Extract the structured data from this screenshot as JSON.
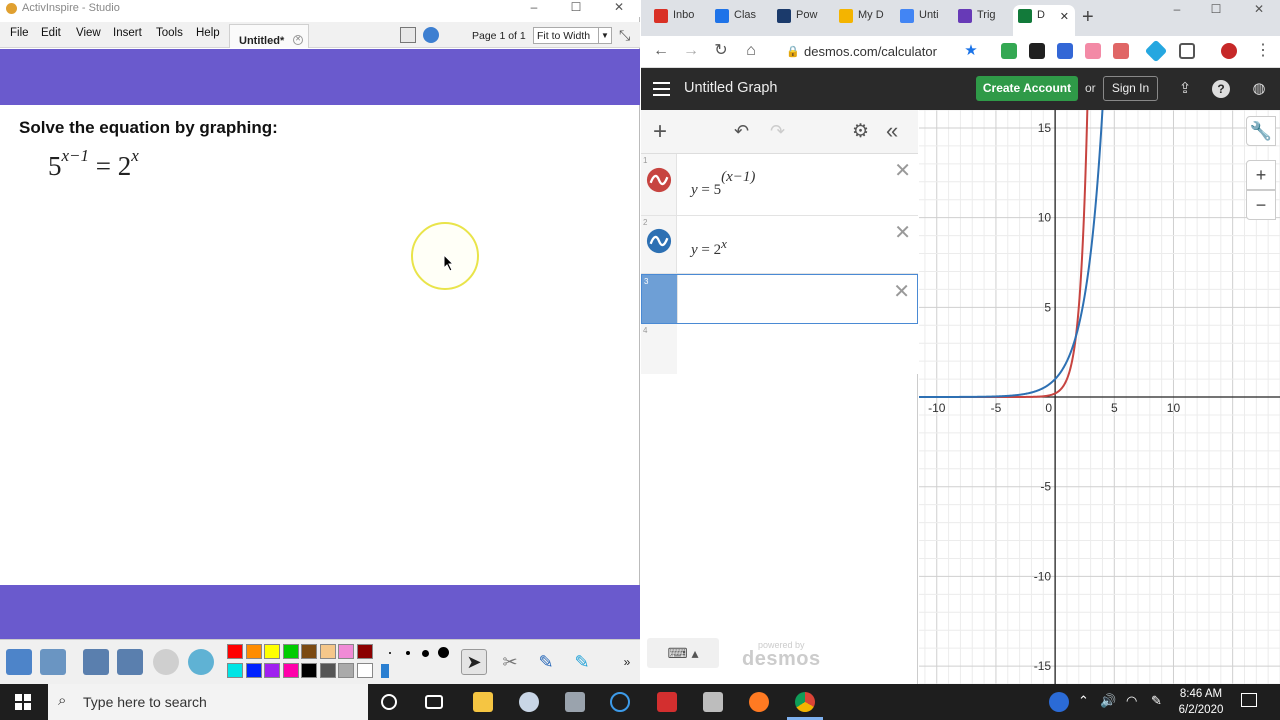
{
  "activinspire": {
    "window_title": "ActivInspire - Studio",
    "menu": [
      "File",
      "Edit",
      "View",
      "Insert",
      "Tools",
      "Help"
    ],
    "tab_label": "Untitled*",
    "page_indicator": "Page 1 of 1",
    "zoom": "Fit to Width",
    "band_color": "#6a5acd",
    "problem_text": "Solve the equation by graphing:",
    "equation": {
      "left_base": "5",
      "left_exp": "x−1",
      "equals": "=",
      "right_base": "2",
      "right_exp": "x"
    },
    "palette": [
      "#ff0000",
      "#ff8c00",
      "#ffff00",
      "#00cc00",
      "#7b4a12",
      "#f5c78a",
      "#f08ad6",
      "#8b0000",
      "#00e5e5",
      "#0022ff",
      "#a020f0",
      "#ff00aa",
      "#000000",
      "#555555",
      "#aaaaaa",
      "#ffffff"
    ]
  },
  "chrome": {
    "tabs": [
      {
        "label": "Inbo",
        "icon": "gmail-icon",
        "color": "#d93025"
      },
      {
        "label": "Clas",
        "icon": "classroom-icon",
        "color": "#1e73e8"
      },
      {
        "label": "Pow",
        "icon": "powerpoint-icon",
        "color": "#1b3a6b"
      },
      {
        "label": "My D",
        "icon": "drive-icon",
        "color": "#f4b400"
      },
      {
        "label": "Unti",
        "icon": "docs-icon",
        "color": "#4285f4"
      },
      {
        "label": "Trig",
        "icon": "forms-icon",
        "color": "#673ab7"
      },
      {
        "label": "D",
        "icon": "desmos-icon",
        "color": "#127a3a"
      }
    ],
    "url": "desmos.com/calculator"
  },
  "desmos": {
    "graph_title": "Untitled Graph",
    "create_account": "Create Account",
    "or": "or",
    "sign_in": "Sign In",
    "expressions": [
      {
        "num": "1",
        "lhs": "y",
        "eq": "=",
        "base": "5",
        "exp": "(x−1)",
        "color": "#c74440"
      },
      {
        "num": "2",
        "lhs": "y",
        "eq": "=",
        "base": "2",
        "exp": "x",
        "color": "#2d70b3"
      },
      {
        "num": "3"
      },
      {
        "num": "4"
      }
    ],
    "powered_by": "powered by",
    "brand": "desmos",
    "graph": {
      "x_range": [
        -11.5,
        19
      ],
      "y_range": [
        -16,
        16
      ],
      "x_ticks": [
        "-10",
        "-5",
        "0",
        "5",
        "10"
      ],
      "y_ticks": [
        "15",
        "10",
        "5",
        "-5",
        "-10",
        "-15"
      ]
    }
  },
  "taskbar": {
    "search_placeholder": "Type here to search",
    "time": "8:46 AM",
    "date": "6/2/2020"
  }
}
